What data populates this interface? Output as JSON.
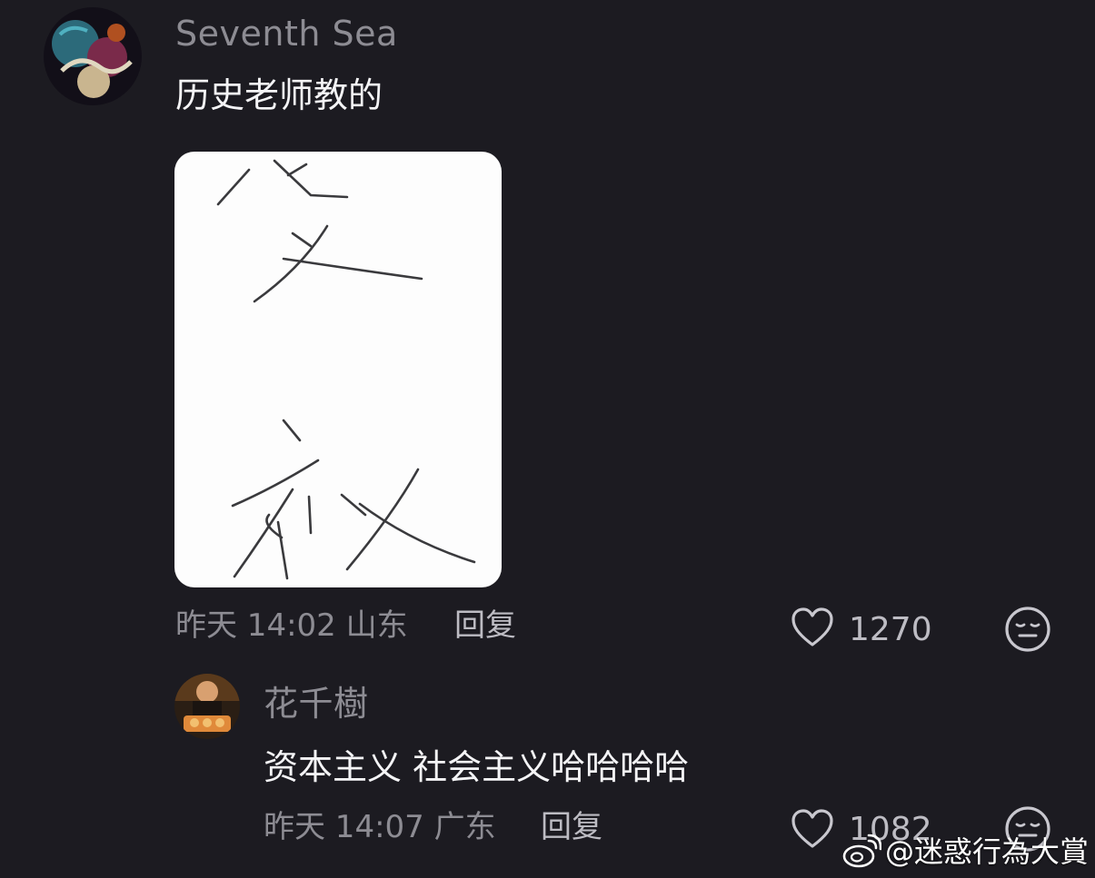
{
  "comments": [
    {
      "username": "Seventh Sea",
      "text": "历史老师教的",
      "meta": "昨天 14:02 山东",
      "reply_label": "回复",
      "like_count": "1270",
      "image": {
        "handwritten_chars": [
          "资",
          "社"
        ]
      }
    },
    {
      "username": "花千樹",
      "text": "资本主义 社会主义哈哈哈哈",
      "meta": "昨天 14:07 广东",
      "reply_label": "回复",
      "like_count": "1082"
    }
  ],
  "watermark": {
    "text": "@迷惑行為大賞",
    "icon": "weibo-icon"
  },
  "icons": {
    "like": "heart-outline-icon",
    "reaction": "neutral-face-icon"
  },
  "colors": {
    "background": "#1c1b21",
    "secondary_text": "#8d8c93",
    "primary_text": "#f4f4f6"
  }
}
